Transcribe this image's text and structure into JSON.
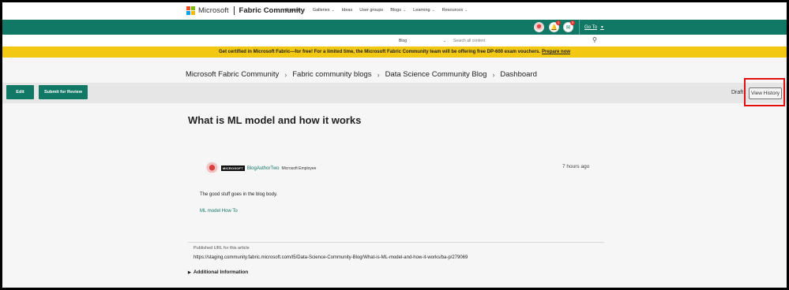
{
  "header": {
    "brand_ms": "Microsoft",
    "brand_community": "Fabric Community",
    "nav": [
      {
        "label": "Forums",
        "dropdown": true
      },
      {
        "label": "Galleries",
        "dropdown": true
      },
      {
        "label": "Ideas",
        "dropdown": false
      },
      {
        "label": "User groups",
        "dropdown": false
      },
      {
        "label": "Blogs",
        "dropdown": true
      },
      {
        "label": "Learning",
        "dropdown": true
      },
      {
        "label": "Resources",
        "dropdown": true
      }
    ],
    "notifications_count": "1",
    "messages_count": "0",
    "goto_label": "Go To"
  },
  "search": {
    "scope": "Blog",
    "placeholder": "Search all content"
  },
  "banner": {
    "text": "Get certified in Microsoft Fabric—for free! For a limited time, the Microsoft Fabric Community team will be offering free DP-600 exam vouchers.",
    "link": "Prepare now"
  },
  "breadcrumb": [
    "Microsoft Fabric Community",
    "Fabric community blogs",
    "Data Science Community Blog",
    "Dashboard"
  ],
  "toolbar": {
    "edit_label": "Edit",
    "submit_label": "Submit for Review",
    "status": "Draft",
    "history_label": "View History"
  },
  "article": {
    "title": "What is ML model and how it works",
    "ms_badge": "MICROSOFT",
    "author": "BlogAuthorTwo",
    "role": "Microsoft Employee",
    "time": "7 hours ago",
    "body": "The good stuff goes in the blog body.",
    "tag": "ML model How To",
    "url_label": "Published URL for this article",
    "url": "https://staging.community.fabric.microsoft.com/t5/Data-Science-Community-Blog/What-is-ML-model-and-how-it-works/ba-p/279069",
    "additional": "Additional Information"
  },
  "colors": {
    "brand": "#117865",
    "banner": "#f2c812",
    "highlight": "#e01010"
  }
}
